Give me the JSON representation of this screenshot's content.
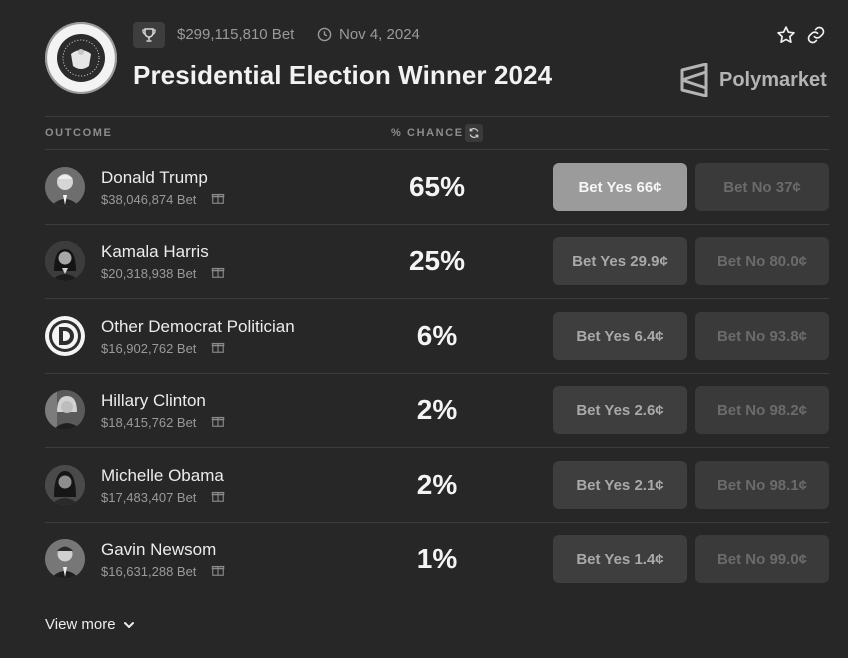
{
  "market": {
    "volume": "$299,115,810 Bet",
    "date": "Nov 4, 2024",
    "title": "Presidential Election Winner 2024",
    "brand": "Polymarket"
  },
  "columns": {
    "outcome": "OUTCOME",
    "chance": "% CHANCE"
  },
  "outcomes": [
    {
      "name": "Donald Trump",
      "volume": "$38,046,874 Bet",
      "chance": "65%",
      "yes": "Bet Yes 66¢",
      "no": "Bet No 37¢"
    },
    {
      "name": "Kamala Harris",
      "volume": "$20,318,938 Bet",
      "chance": "25%",
      "yes": "Bet Yes 29.9¢",
      "no": "Bet No 80.0¢"
    },
    {
      "name": "Other Democrat Politician",
      "volume": "$16,902,762 Bet",
      "chance": "6%",
      "yes": "Bet Yes 6.4¢",
      "no": "Bet No 93.8¢"
    },
    {
      "name": "Hillary Clinton",
      "volume": "$18,415,762 Bet",
      "chance": "2%",
      "yes": "Bet Yes 2.6¢",
      "no": "Bet No 98.2¢"
    },
    {
      "name": "Michelle Obama",
      "volume": "$17,483,407 Bet",
      "chance": "2%",
      "yes": "Bet Yes 2.1¢",
      "no": "Bet No 98.1¢"
    },
    {
      "name": "Gavin Newsom",
      "volume": "$16,631,288 Bet",
      "chance": "1%",
      "yes": "Bet Yes 1.4¢",
      "no": "Bet No 99.0¢"
    }
  ],
  "footer": {
    "view_more": "View more"
  }
}
